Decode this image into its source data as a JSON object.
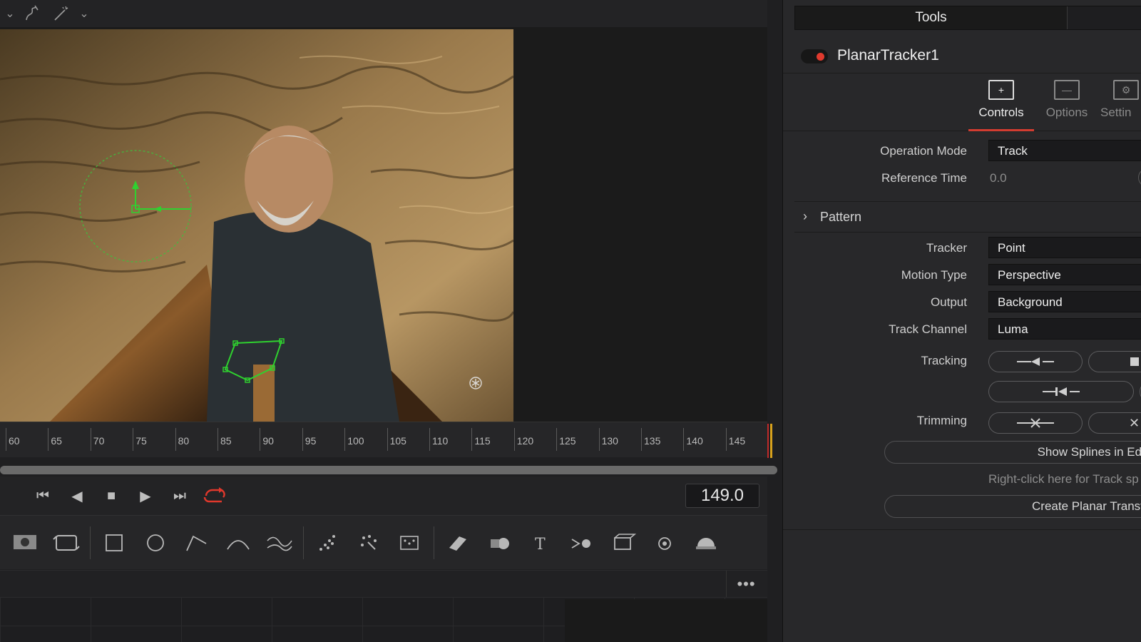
{
  "timeline": {
    "ticks": [
      "60",
      "65",
      "70",
      "75",
      "80",
      "85",
      "90",
      "95",
      "100",
      "105",
      "110",
      "115",
      "120",
      "125",
      "130",
      "135",
      "140",
      "145"
    ],
    "timecode": "149.0",
    "scrub_progress": 1.0
  },
  "inspector": {
    "tab": "Tools",
    "node_name": "PlanarTracker1",
    "mode_tabs": [
      "Controls",
      "Options",
      "Settin"
    ],
    "operation_mode": {
      "label": "Operation Mode",
      "value": "Track"
    },
    "reference_time": {
      "label": "Reference Time",
      "value": "0.0"
    },
    "pattern": "Pattern",
    "tracker": {
      "label": "Tracker",
      "value": "Point"
    },
    "motion_type": {
      "label": "Motion Type",
      "value": "Perspective"
    },
    "output": {
      "label": "Output",
      "value": "Background"
    },
    "track_channel": {
      "label": "Track Channel",
      "value": "Luma"
    },
    "tracking_label": "Tracking",
    "trimming_label": "Trimming",
    "show_splines": "Show Splines in Edito",
    "hint": "Right-click here for Track sp",
    "create_planar": "Create Planar Transfor"
  },
  "colors": {
    "accent": "#d33c30",
    "playhead": "#d7a11c",
    "tracker_green": "#2fd12f"
  }
}
